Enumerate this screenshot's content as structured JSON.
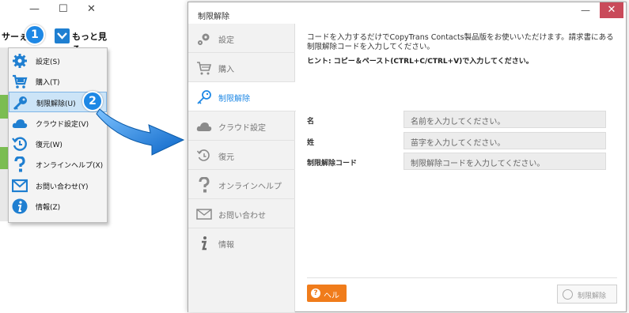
{
  "left_window": {
    "minimize": "—",
    "maximize": "☐",
    "close": "✕",
    "service_label": "サーぇ",
    "more_label": "もっと見る",
    "badge1": "1",
    "badge2": "2",
    "menu": [
      {
        "icon": "gear-icon",
        "label": "設定(S)"
      },
      {
        "icon": "cart-icon",
        "label": "購入(T)"
      },
      {
        "icon": "key-icon",
        "label": "制限解除(U)",
        "selected": true
      },
      {
        "icon": "cloud-icon",
        "label": "クラウド設定(V)"
      },
      {
        "icon": "restore-icon",
        "label": "復元(W)"
      },
      {
        "icon": "question-icon",
        "label": "オンラインヘルプ(X)"
      },
      {
        "icon": "mail-icon",
        "label": "お問い合わせ(Y)"
      },
      {
        "icon": "info-icon",
        "label": "情報(Z)"
      }
    ]
  },
  "main_window": {
    "title": "制限解除",
    "minimize": "—",
    "close": "✕",
    "sidebar": [
      {
        "icon": "gear-icon",
        "label": "設定"
      },
      {
        "icon": "cart-icon",
        "label": "購入"
      },
      {
        "icon": "key-icon",
        "label": "制限解除",
        "active": true
      },
      {
        "icon": "cloud-icon",
        "label": "クラウド設定"
      },
      {
        "icon": "restore-icon",
        "label": "復元"
      },
      {
        "icon": "question-icon",
        "label": "オンラインヘルプ"
      },
      {
        "icon": "mail-icon",
        "label": "お問い合わせ"
      },
      {
        "icon": "info-icon",
        "label": "情報"
      }
    ],
    "intro": "コードを入力するだけでCopyTrans Contacts製品版をお使いいただけます。請求書にある制限解除コードを入力してください。",
    "hint": "ヒント: コピー＆ペースト(CTRL+C/CTRL+V)で入力してください。",
    "fields": [
      {
        "label": "名",
        "placeholder": "名前を入力してください。"
      },
      {
        "label": "姓",
        "placeholder": "苗字を入力してください。"
      },
      {
        "label": "制限解除コード",
        "placeholder": "制限解除コードを入力してください。"
      }
    ],
    "help_button": "ヘルプ",
    "unlock_button": "制限解除"
  },
  "colors": {
    "accent_blue": "#1e88e5",
    "help_orange": "#f07c1b",
    "close_red": "#c94a5a"
  }
}
